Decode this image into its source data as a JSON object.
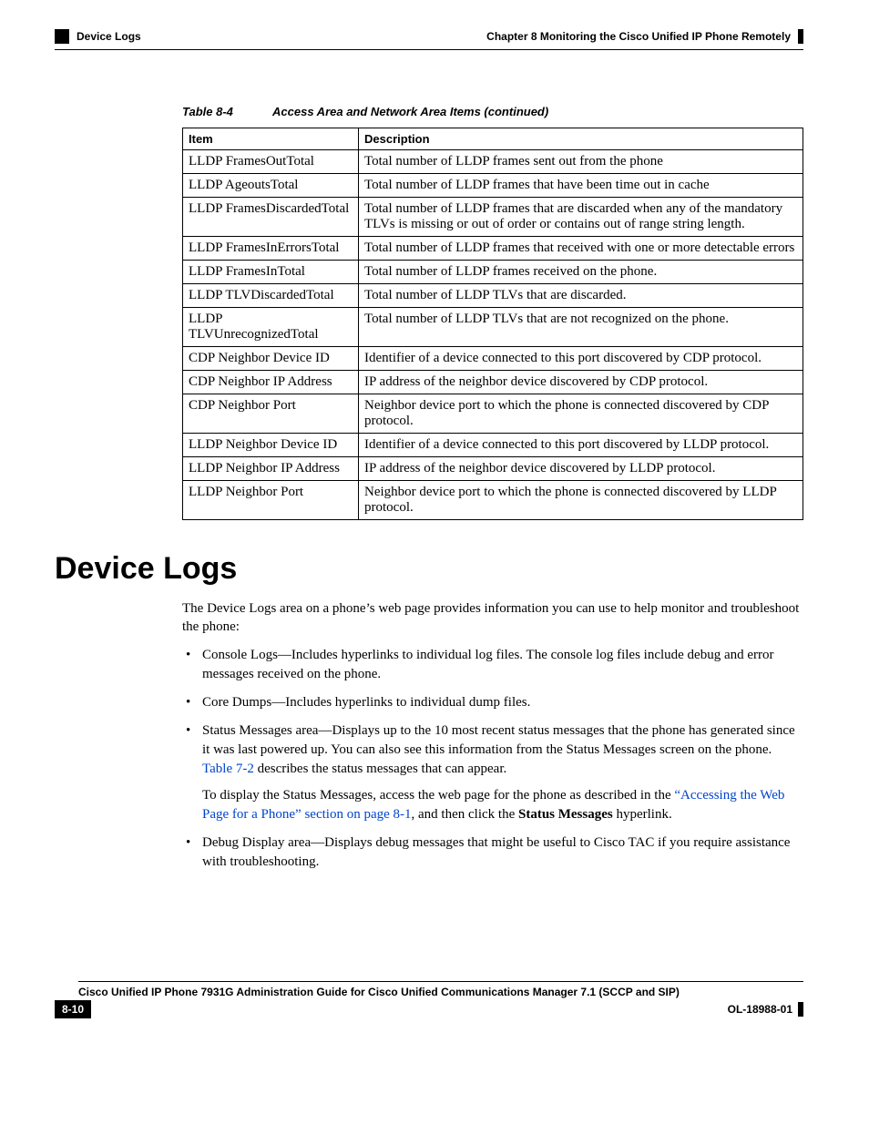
{
  "header": {
    "section": "Device Logs",
    "chapter": "Chapter 8      Monitoring the Cisco Unified IP Phone Remotely"
  },
  "table": {
    "caption_num": "Table 8-4",
    "caption_title": "Access Area and Network Area Items (continued)",
    "col_item": "Item",
    "col_desc": "Description",
    "rows": [
      {
        "item": "LLDP FramesOutTotal",
        "desc": "Total number of LLDP frames sent out from the phone"
      },
      {
        "item": "LLDP AgeoutsTotal",
        "desc": "Total number of LLDP frames that have been time out in cache"
      },
      {
        "item": "LLDP FramesDiscardedTotal",
        "desc": "Total number of LLDP frames that are discarded when any of the mandatory TLVs is missing or out of order or contains out of range string length."
      },
      {
        "item": "LLDP FramesInErrorsTotal",
        "desc": "Total number of LLDP frames that received with one or more detectable errors"
      },
      {
        "item": "LLDP FramesInTotal",
        "desc": "Total number of LLDP frames received on the phone."
      },
      {
        "item": "LLDP TLVDiscardedTotal",
        "desc": "Total number of LLDP TLVs that are discarded."
      },
      {
        "item": "LLDP TLVUnrecognizedTotal",
        "desc": "Total number of LLDP TLVs that are not recognized on the phone."
      },
      {
        "item": "CDP Neighbor Device ID",
        "desc": "Identifier of a device connected to this port discovered by CDP protocol."
      },
      {
        "item": "CDP Neighbor IP Address",
        "desc": "IP address of the neighbor device discovered by CDP protocol."
      },
      {
        "item": "CDP Neighbor Port",
        "desc": "Neighbor device port to which the phone is connected discovered by CDP protocol."
      },
      {
        "item": "LLDP Neighbor Device ID",
        "desc": "Identifier of a device connected to this port discovered by LLDP protocol."
      },
      {
        "item": "LLDP Neighbor IP Address",
        "desc": "IP address of the neighbor device discovered by LLDP protocol."
      },
      {
        "item": "LLDP Neighbor Port",
        "desc": "Neighbor device port to which the phone is connected discovered by LLDP protocol."
      }
    ]
  },
  "section": {
    "title": "Device Logs",
    "intro": "The Device Logs area on a phone’s web page provides information you can use to help monitor and troubleshoot the phone:",
    "bullets": {
      "b0": "Console Logs—Includes hyperlinks to individual log files. The console log files include debug and error messages received on the phone.",
      "b1": "Core Dumps—Includes hyperlinks to individual dump files.",
      "b2_a": "Status Messages area—Displays up to the 10 most recent status messages that the phone has generated since it was last powered up. You can also see this information from the Status Messages screen on the phone. ",
      "b2_link1": "Table 7-2",
      "b2_b": " describes the status messages that can appear.",
      "b2_sub_a": "To display the Status Messages, access the web page for the phone as described in the ",
      "b2_sub_link": "“Accessing the Web Page for a Phone” section on page 8-1",
      "b2_sub_b": ", and then click the ",
      "b2_sub_bold": "Status Messages",
      "b2_sub_c": " hyperlink.",
      "b3": "Debug Display area—Displays debug messages that might be useful to Cisco TAC if you require assistance with troubleshooting."
    }
  },
  "footer": {
    "guide": "Cisco Unified IP Phone 7931G Administration Guide for Cisco Unified Communications Manager 7.1 (SCCP and SIP)",
    "page": "8-10",
    "doc": "OL-18988-01"
  }
}
